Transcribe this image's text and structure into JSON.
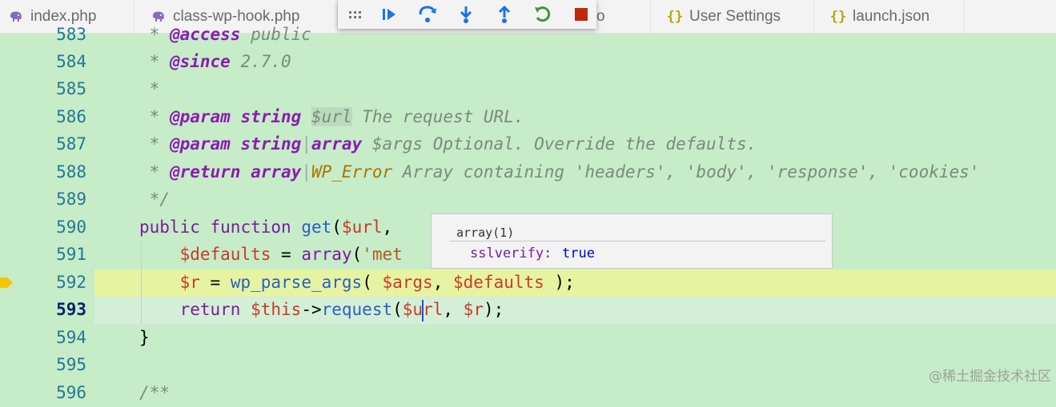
{
  "tabs": [
    {
      "label": "index.php",
      "icon": "php-elephant-icon"
    },
    {
      "label": "class-wp-hook.php",
      "icon": "php-elephant-icon"
    },
    {
      "label": "o",
      "icon": ""
    },
    {
      "label": "User Settings",
      "icon": "json-braces-icon"
    },
    {
      "label": "launch.json",
      "icon": "json-braces-icon"
    }
  ],
  "debug_toolbar": {
    "actions": [
      "continue",
      "step-over",
      "step-into",
      "step-out",
      "restart",
      "stop"
    ],
    "colors": {
      "blue": "#1a73e8",
      "green": "#3a9a3a",
      "red": "#c0280a"
    }
  },
  "lines": [
    {
      "num": "583",
      "text": " * @access public"
    },
    {
      "num": "584",
      "text": " * @since 2.7.0"
    },
    {
      "num": "585",
      "text": " *"
    },
    {
      "num": "586",
      "text": " * @param string $url The request URL."
    },
    {
      "num": "587",
      "text": " * @param string|array $args Optional. Override the defaults."
    },
    {
      "num": "588",
      "text": " * @return array|WP_Error Array containing 'headers', 'body', 'response', 'cookies'"
    },
    {
      "num": "589",
      "text": " */"
    },
    {
      "num": "590",
      "text": "public function get($url,"
    },
    {
      "num": "591",
      "text": "    $defaults = array('met"
    },
    {
      "num": "592",
      "text": "    $r = wp_parse_args( $args, $defaults );"
    },
    {
      "num": "593",
      "text": "    return $this->request($url, $r);"
    },
    {
      "num": "594",
      "text": "}"
    },
    {
      "num": "595",
      "text": ""
    },
    {
      "num": "596",
      "text": "/**"
    }
  ],
  "hover": {
    "title": "array(1)",
    "key": "sslverify:",
    "value": "true"
  },
  "watermark": "@稀土掘金技术社区"
}
